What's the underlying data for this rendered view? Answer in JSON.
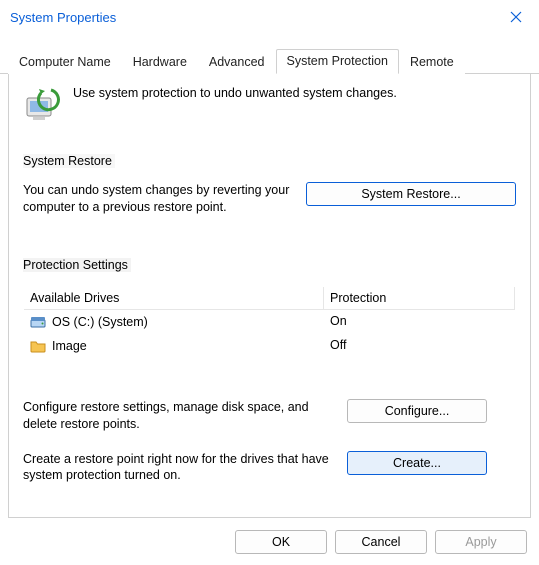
{
  "window": {
    "title": "System Properties"
  },
  "tabs": [
    {
      "label": "Computer Name"
    },
    {
      "label": "Hardware"
    },
    {
      "label": "Advanced"
    },
    {
      "label": "System Protection",
      "active": true
    },
    {
      "label": "Remote"
    }
  ],
  "header": {
    "text": "Use system protection to undo unwanted system changes."
  },
  "restore": {
    "title": "System Restore",
    "text": "You can undo system changes by reverting your computer to a previous restore point.",
    "button": "System Restore..."
  },
  "protection": {
    "title": "Protection Settings",
    "columns": {
      "drive": "Available Drives",
      "protection": "Protection"
    },
    "rows": [
      {
        "icon": "disk-icon",
        "name": "OS (C:) (System)",
        "protection": "On"
      },
      {
        "icon": "folder-icon",
        "name": "Image",
        "protection": "Off"
      }
    ],
    "configure": {
      "text": "Configure restore settings, manage disk space, and delete restore points.",
      "button": "Configure..."
    },
    "create": {
      "text": "Create a restore point right now for the drives that have system protection turned on.",
      "button": "Create..."
    }
  },
  "footer": {
    "ok": "OK",
    "cancel": "Cancel",
    "apply": "Apply"
  }
}
